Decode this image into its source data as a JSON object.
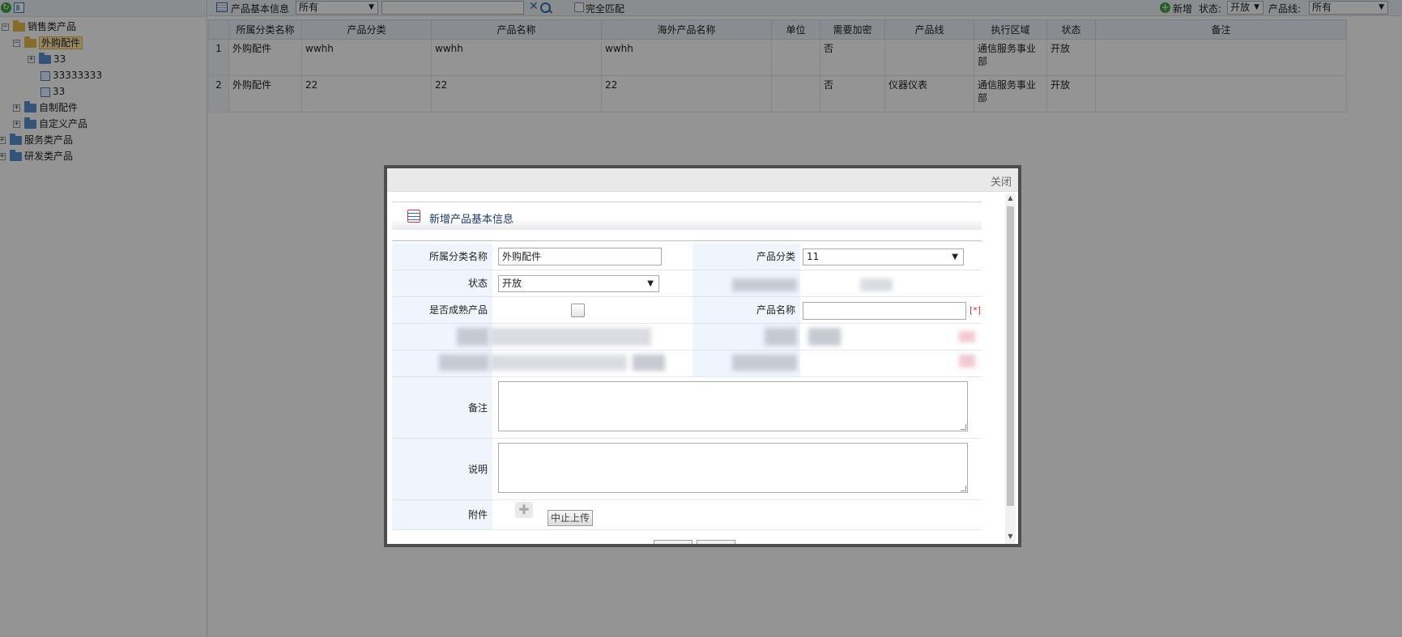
{
  "tree": {
    "nodes": [
      {
        "label": "销售类产品",
        "toggle": "−"
      },
      {
        "label": "外购配件",
        "toggle": "−"
      },
      {
        "label": "33",
        "toggle": "+"
      },
      {
        "label": "33333333"
      },
      {
        "label": "33"
      },
      {
        "label": "自制配件",
        "toggle": "+"
      },
      {
        "label": "自定义产品",
        "toggle": "+"
      },
      {
        "label": "服务类产品",
        "toggle": "+"
      },
      {
        "label": "研发类产品",
        "toggle": "+"
      }
    ]
  },
  "toolbar": {
    "title": "产品基本信息",
    "scope_select": "所有",
    "search_value": "",
    "clear_glyph": "✕",
    "exact_match": "完全匹配",
    "add_label": "新增",
    "status_label": "状态:",
    "status_value": "开放",
    "line_label": "产品线:",
    "line_value": "所有",
    "arrow": "▼"
  },
  "grid": {
    "columns": [
      "所属分类名称",
      "产品分类",
      "产品名称",
      "海外产品名称",
      "单位",
      "需要加密",
      "产品线",
      "执行区域",
      "状态",
      "备注"
    ],
    "rows": [
      {
        "no": "1",
        "cells": [
          "外购配件",
          "wwhh",
          "wwhh",
          "wwhh",
          "",
          "否",
          "",
          "通信服务事业部",
          "开放",
          ""
        ]
      },
      {
        "no": "2",
        "cells": [
          "外购配件",
          "22",
          "22",
          "22",
          "",
          "否",
          "仪器仪表",
          "通信服务事业部",
          "开放",
          ""
        ]
      }
    ]
  },
  "dialog": {
    "close_label": "关闭",
    "form_title": "新增产品基本信息",
    "fields": {
      "category_label": "所属分类名称",
      "category_value": "外购配件",
      "product_class_label": "产品分类",
      "product_class_value": "11",
      "status_label": "状态",
      "status_value": "开放",
      "mature_label": "是否成熟产品",
      "name_label": "产品名称",
      "name_value": "",
      "required_mark": "[*]",
      "remark_label": "备注",
      "desc_label": "说明",
      "attach_label": "附件",
      "stop_upload": "中止上传"
    }
  },
  "scroll": {
    "up": "▲",
    "down": "▼"
  }
}
